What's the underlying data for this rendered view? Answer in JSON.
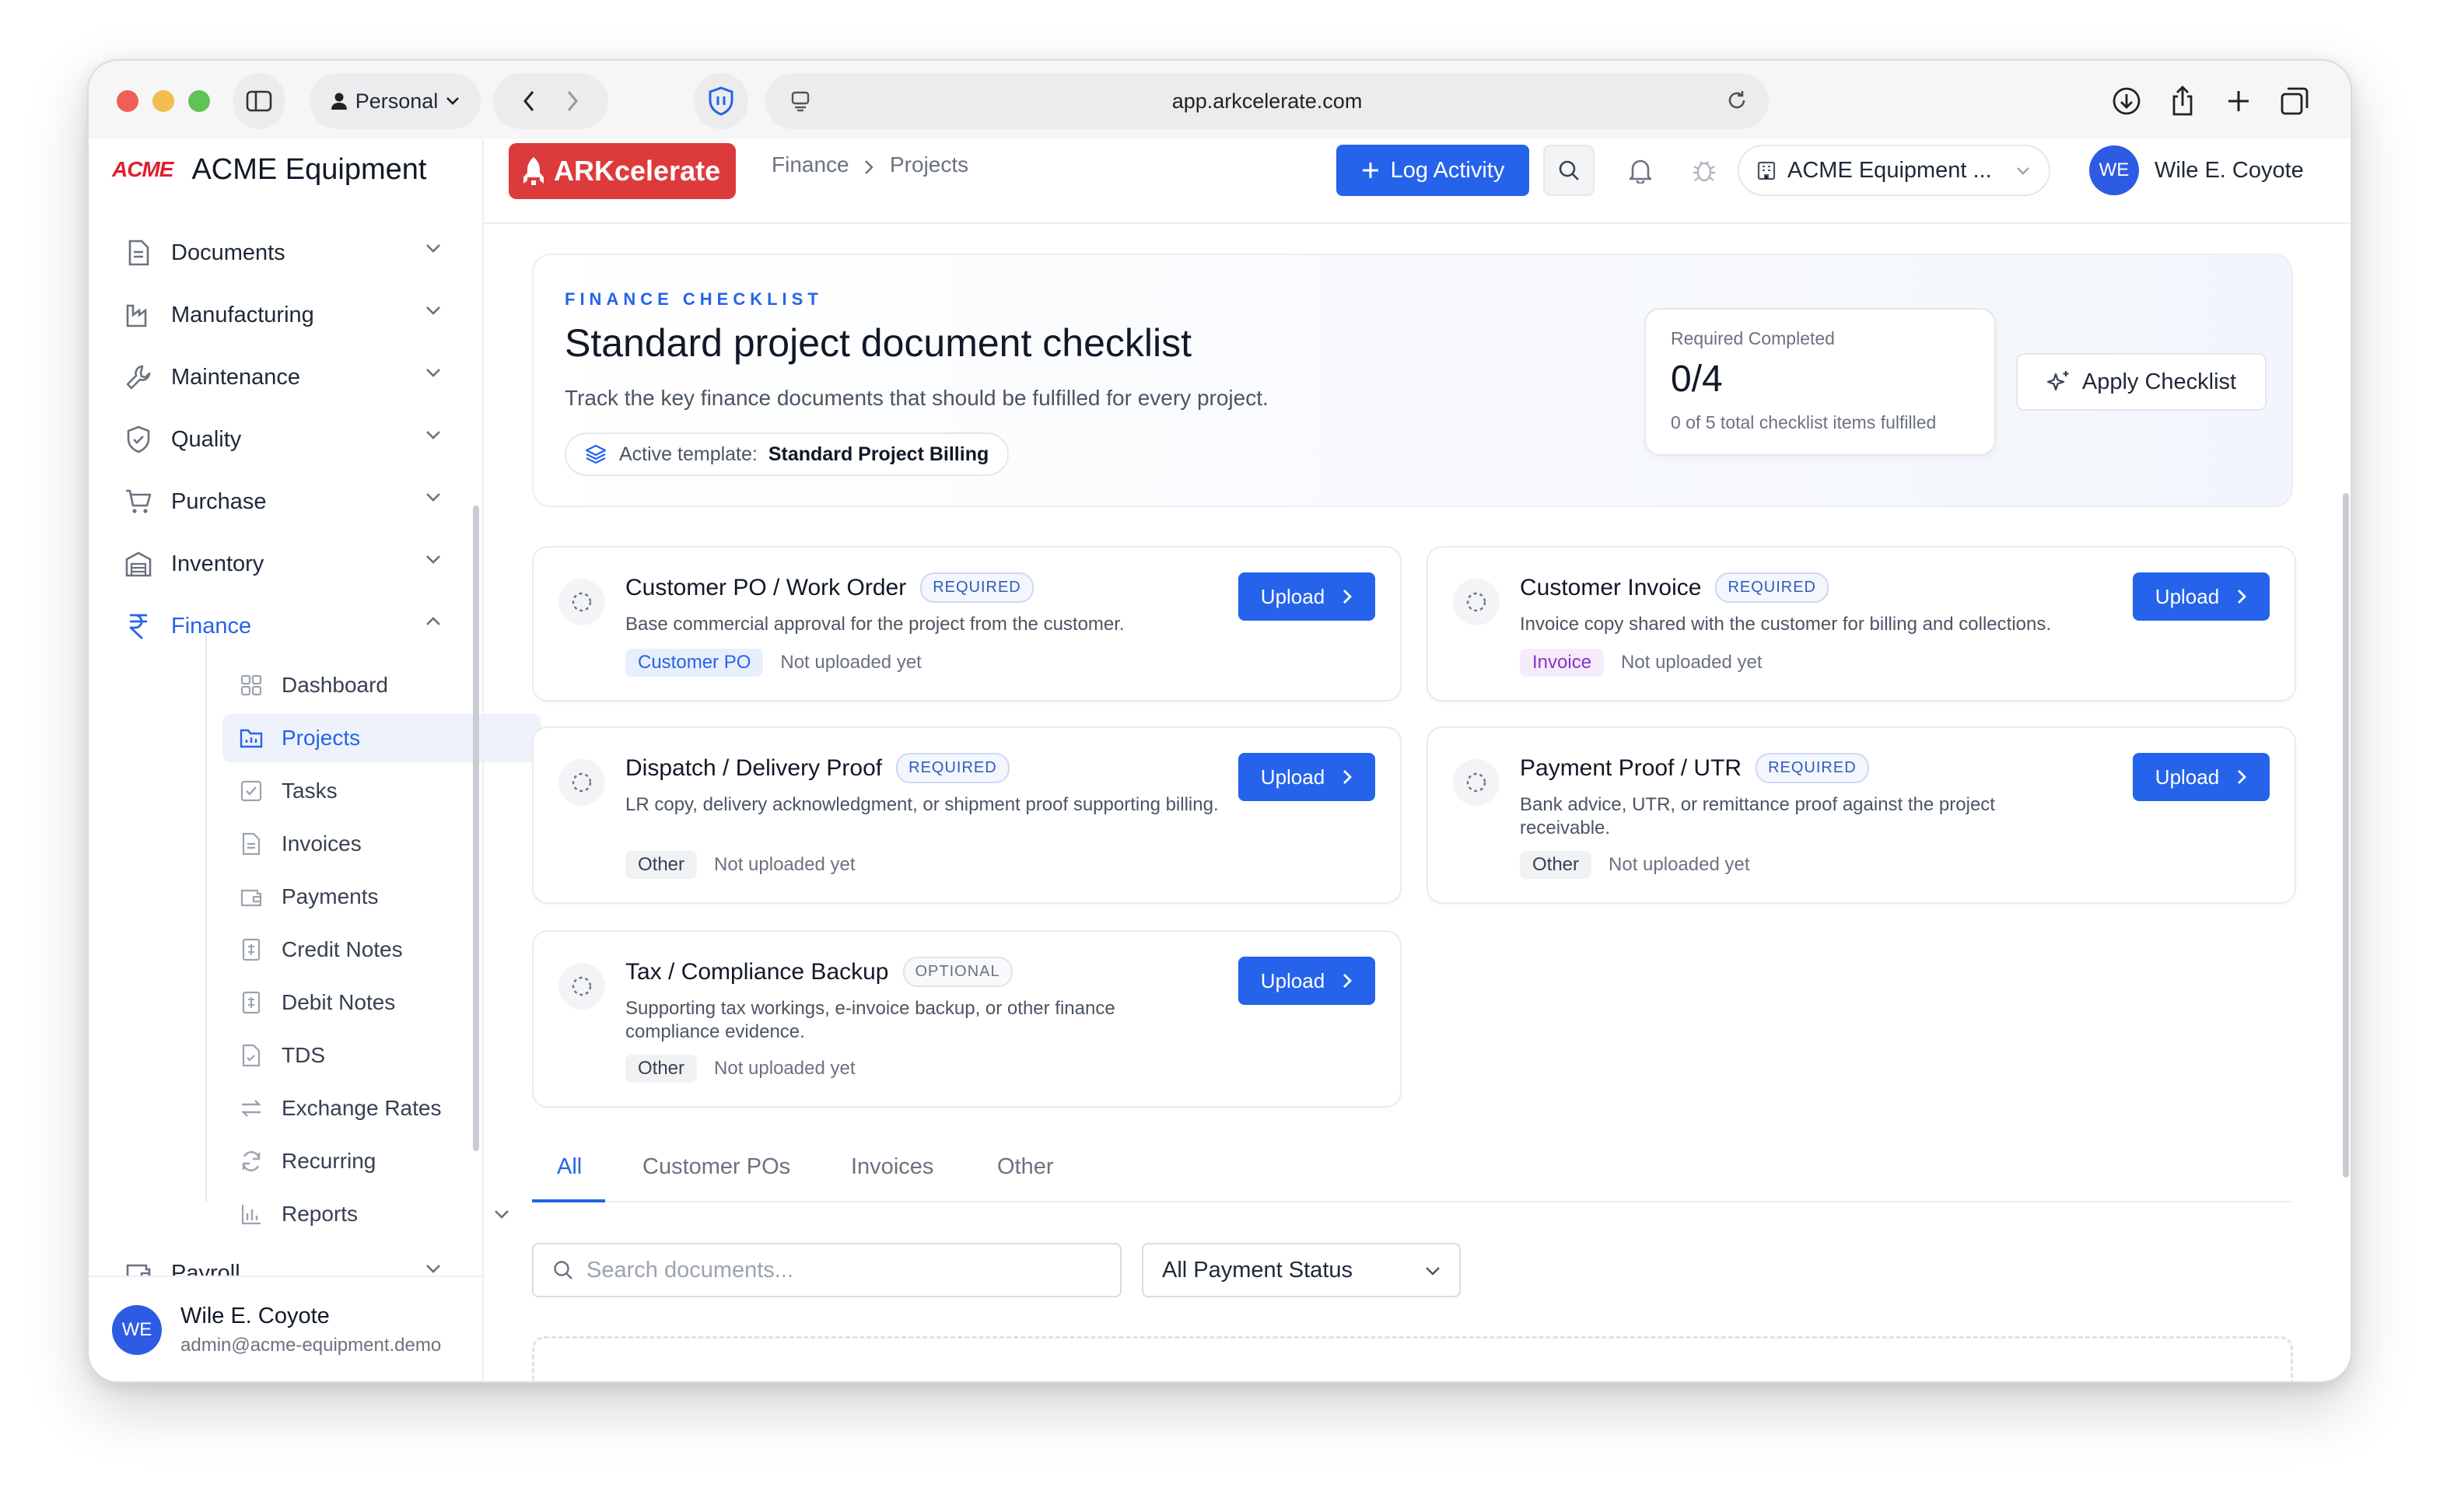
{
  "browser": {
    "profile": "Personal",
    "url": "app.arkcelerate.com"
  },
  "sidebar": {
    "brand_logo": "ACME",
    "brand_name": "ACME Equipment",
    "items": [
      {
        "label": "Documents",
        "icon": "document-icon"
      },
      {
        "label": "Manufacturing",
        "icon": "factory-icon"
      },
      {
        "label": "Maintenance",
        "icon": "wrench-icon"
      },
      {
        "label": "Quality",
        "icon": "shield-check-icon"
      },
      {
        "label": "Purchase",
        "icon": "cart-icon"
      },
      {
        "label": "Inventory",
        "icon": "warehouse-icon"
      },
      {
        "label": "Finance",
        "icon": "rupee-icon"
      }
    ],
    "finance_sub": [
      {
        "label": "Dashboard"
      },
      {
        "label": "Projects"
      },
      {
        "label": "Tasks"
      },
      {
        "label": "Invoices"
      },
      {
        "label": "Payments"
      },
      {
        "label": "Credit Notes"
      },
      {
        "label": "Debit Notes"
      },
      {
        "label": "TDS"
      },
      {
        "label": "Exchange Rates"
      },
      {
        "label": "Recurring"
      },
      {
        "label": "Reports"
      }
    ],
    "payroll_label": "Payroll",
    "user": {
      "initials": "WE",
      "name": "Wile E. Coyote",
      "email": "admin@acme-equipment.demo"
    }
  },
  "header": {
    "app_name": "ARKcelerate",
    "breadcrumb": [
      "Finance",
      "Projects"
    ],
    "log_activity": "Log Activity",
    "org": "ACME Equipment ...",
    "user_initials": "WE",
    "user_name": "Wile E. Coyote"
  },
  "checklist": {
    "eyebrow": "FINANCE CHECKLIST",
    "title": "Standard project document checklist",
    "subtitle": "Track the key finance documents that should be fulfilled for every project.",
    "template_label": "Active template:",
    "template_name": "Standard Project Billing",
    "required_label": "Required Completed",
    "required_value": "0/4",
    "required_note": "0 of 5 total checklist items fulfilled",
    "apply_label": "Apply Checklist"
  },
  "documents": [
    {
      "title": "Customer PO / Work Order",
      "badge": "REQUIRED",
      "desc": "Base commercial approval for the project from the customer.",
      "tag": "Customer PO",
      "status": "Not uploaded yet",
      "upload": "Upload"
    },
    {
      "title": "Customer Invoice",
      "badge": "REQUIRED",
      "desc": "Invoice copy shared with the customer for billing and collections.",
      "tag": "Invoice",
      "status": "Not uploaded yet",
      "upload": "Upload"
    },
    {
      "title": "Dispatch / Delivery Proof",
      "badge": "REQUIRED",
      "desc": "LR copy, delivery acknowledgment, or shipment proof supporting billing.",
      "tag": "Other",
      "status": "Not uploaded yet",
      "upload": "Upload"
    },
    {
      "title": "Payment Proof / UTR",
      "badge": "REQUIRED",
      "desc": "Bank advice, UTR, or remittance proof against the project receivable.",
      "tag": "Other",
      "status": "Not uploaded yet",
      "upload": "Upload"
    },
    {
      "title": "Tax / Compliance Backup",
      "badge": "OPTIONAL",
      "desc": "Supporting tax workings, e-invoice backup, or other finance compliance evidence.",
      "tag": "Other",
      "status": "Not uploaded yet",
      "upload": "Upload"
    }
  ],
  "tabs": [
    "All",
    "Customer POs",
    "Invoices",
    "Other"
  ],
  "filters": {
    "search_placeholder": "Search documents...",
    "status": "All Payment Status"
  },
  "colors": {
    "accent": "#2563eb",
    "brand_red": "#dd3b3b"
  }
}
